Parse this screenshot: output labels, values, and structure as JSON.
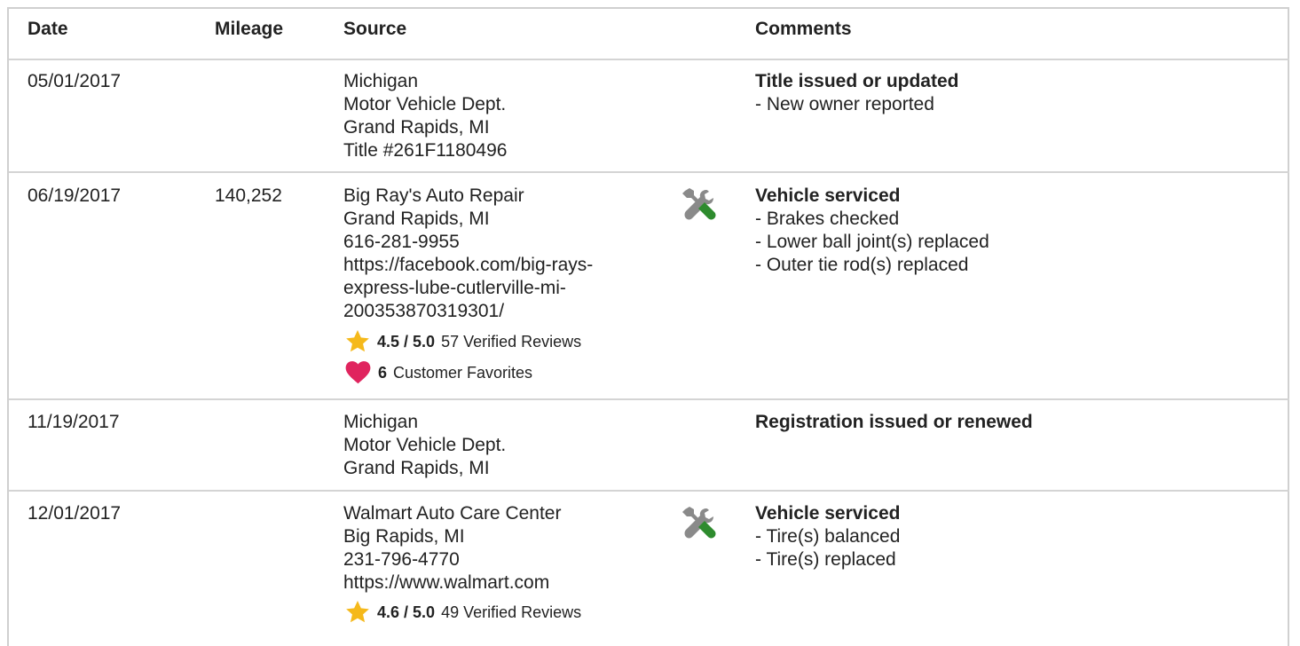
{
  "headers": {
    "date": "Date",
    "mileage": "Mileage",
    "source": "Source",
    "comments": "Comments"
  },
  "colors": {
    "star": "#f5b91b",
    "heart": "#e0245e",
    "wrench_gray": "#8a8a8a",
    "wrench_green": "#2e8b2e",
    "divider": "#d4d4d4"
  },
  "records": [
    {
      "date": "05/01/2017",
      "mileage": "",
      "source": [
        "Michigan",
        "Motor Vehicle Dept.",
        "Grand Rapids, MI",
        "Title #261F1180496"
      ],
      "service_icon": "",
      "comment_title": "Title issued or updated",
      "comment_items": [
        "New owner reported"
      ]
    },
    {
      "date": "06/19/2017",
      "mileage": "140,252",
      "source": [
        "Big Ray's Auto Repair",
        "Grand Rapids, MI",
        "616-281-9955",
        "https://facebook.com/big-rays-",
        "express-lube-cutlerville-mi-",
        "200353870319301/"
      ],
      "rating": {
        "score": "4.5 / 5.0",
        "reviews": "57 Verified Reviews"
      },
      "favorites": {
        "count": "6",
        "label": "Customer Favorites"
      },
      "service_icon": "wrench-screwdriver-icon",
      "comment_title": "Vehicle serviced",
      "comment_items": [
        "Brakes checked",
        "Lower ball joint(s) replaced",
        "Outer tie rod(s) replaced"
      ]
    },
    {
      "date": "11/19/2017",
      "mileage": "",
      "source": [
        "Michigan",
        "Motor Vehicle Dept.",
        "Grand Rapids, MI"
      ],
      "service_icon": "",
      "comment_title": "Registration issued or renewed",
      "comment_items": []
    },
    {
      "date": "12/01/2017",
      "mileage": "",
      "source": [
        "Walmart Auto Care Center",
        "Big Rapids, MI",
        "231-796-4770",
        "https://www.walmart.com"
      ],
      "rating": {
        "score": "4.6 / 5.0",
        "reviews": "49 Verified Reviews"
      },
      "service_icon": "wrench-screwdriver-icon",
      "comment_title": "Vehicle serviced",
      "comment_items": [
        "Tire(s) balanced",
        "Tire(s) replaced"
      ]
    }
  ]
}
